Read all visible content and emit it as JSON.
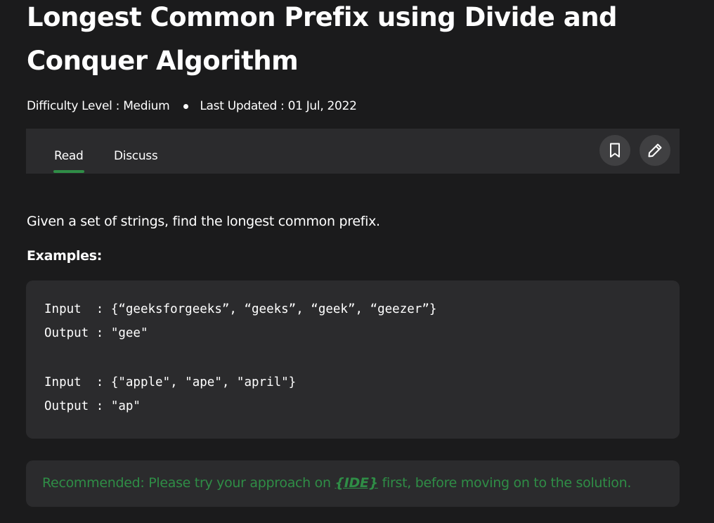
{
  "article": {
    "title": "Longest Common Prefix using Divide and Conquer Algorithm",
    "difficulty": "Difficulty Level : Medium",
    "last_updated": "Last Updated : 01 Jul, 2022"
  },
  "tabs": {
    "read": "Read",
    "discuss": "Discuss",
    "active": "Read"
  },
  "toolbar": {
    "icons": [
      "bookmark-icon",
      "edit-pencil-icon"
    ]
  },
  "content": {
    "intro": "Given a set of strings, find the longest common prefix.",
    "examples_heading": "Examples:",
    "code_lines": [
      "Input  : {“geeksforgeeks”, “geeks”, “geek”, “geezer”}",
      "Output : \"gee\"",
      "Input  : {\"apple\", \"ape\", \"april\"}",
      "Output : \"ap\""
    ]
  },
  "notice": {
    "prefix": "Recommended: Please try your approach on ",
    "link": "{IDE}",
    "suffix": " first, before moving on to the solution."
  },
  "colors": {
    "background": "#1b1b1c",
    "panel": "#2b2b2d",
    "accent": "#2f8d46",
    "text": "#ffffff"
  }
}
